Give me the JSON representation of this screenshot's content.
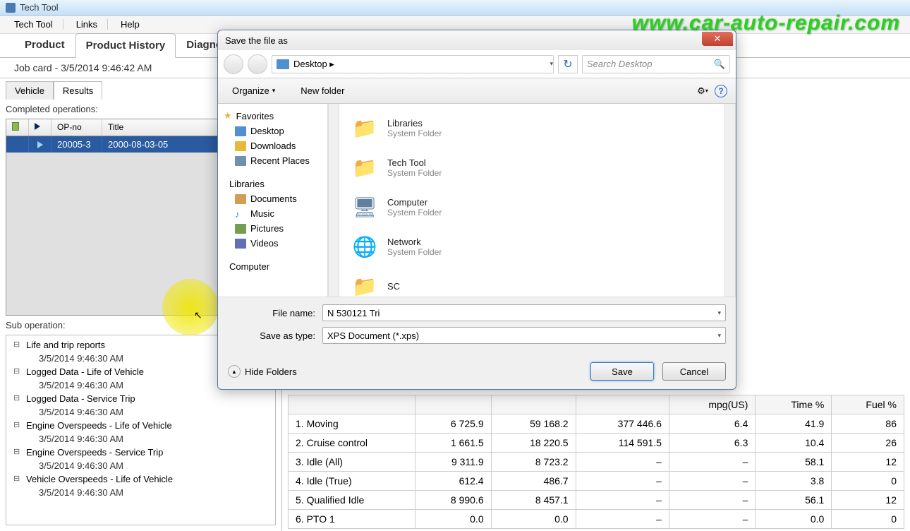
{
  "window": {
    "title": "Tech Tool"
  },
  "menu": {
    "items": [
      "Tech Tool",
      "Links",
      "Help"
    ]
  },
  "main_tabs": {
    "items": [
      "Product",
      "Product History",
      "Diagnose"
    ],
    "active_index": 1
  },
  "job_card": {
    "text": "Job card  -  3/5/2014 9:46:42 AM"
  },
  "sub_tabs": {
    "items": [
      "Vehicle",
      "Results"
    ],
    "active_index": 1
  },
  "ops": {
    "label": "Completed operations:",
    "headers": {
      "op": "OP-no",
      "title": "Title"
    },
    "row": {
      "op": "20005-3",
      "title": "2000-08-03-05"
    }
  },
  "sub_op": {
    "label": "Sub operation:",
    "nodes": [
      {
        "title": "Life and trip reports",
        "time": "3/5/2014 9:46:30 AM"
      },
      {
        "title": "Logged Data - Life of Vehicle",
        "time": "3/5/2014 9:46:30 AM"
      },
      {
        "title": "Logged Data - Service Trip",
        "time": "3/5/2014 9:46:30 AM"
      },
      {
        "title": "Engine Overspeeds - Life of Vehicle",
        "time": "3/5/2014 9:46:30 AM"
      },
      {
        "title": "Engine Overspeeds - Service Trip",
        "time": "3/5/2014 9:46:30 AM"
      },
      {
        "title": "Vehicle Overspeeds - Life of Vehicle",
        "time": "3/5/2014 9:46:30 AM"
      }
    ]
  },
  "data_table": {
    "headers": [
      "",
      "",
      "",
      "",
      "mpg(US)",
      "Time %",
      "Fuel %"
    ],
    "rows": [
      [
        "1. Moving",
        "6 725.9",
        "59 168.2",
        "377 446.6",
        "6.4",
        "41.9",
        "86"
      ],
      [
        "2. Cruise control",
        "1 661.5",
        "18 220.5",
        "114 591.5",
        "6.3",
        "10.4",
        "26"
      ],
      [
        "3. Idle (All)",
        "9 311.9",
        "8 723.2",
        "–",
        "–",
        "58.1",
        "12"
      ],
      [
        "4. Idle (True)",
        "612.4",
        "486.7",
        "–",
        "–",
        "3.8",
        "0"
      ],
      [
        "5. Qualified Idle",
        "8 990.6",
        "8 457.1",
        "–",
        "–",
        "56.1",
        "12"
      ],
      [
        "6. PTO 1",
        "0.0",
        "0.0",
        "–",
        "–",
        "0.0",
        "0"
      ]
    ]
  },
  "dialog": {
    "title": "Save the file as",
    "breadcrumb": "Desktop  ▸",
    "search_placeholder": "Search Desktop",
    "toolbar": {
      "organize": "Organize",
      "newfolder": "New folder"
    },
    "sidebar": {
      "favorites": "Favorites",
      "fav_items": [
        "Desktop",
        "Downloads",
        "Recent Places"
      ],
      "libraries": "Libraries",
      "lib_items": [
        "Documents",
        "Music",
        "Pictures",
        "Videos"
      ],
      "computer": "Computer"
    },
    "files": [
      {
        "name": "Libraries",
        "sub": "System Folder",
        "icon": "folder"
      },
      {
        "name": "Tech Tool",
        "sub": "System Folder",
        "icon": "folder"
      },
      {
        "name": "Computer",
        "sub": "System Folder",
        "icon": "computer"
      },
      {
        "name": "Network",
        "sub": "System Folder",
        "icon": "network"
      },
      {
        "name": "SC",
        "sub": "",
        "icon": "folder"
      }
    ],
    "filename_label": "File name:",
    "filename_value": "N 530121 Tri",
    "saveas_label": "Save as type:",
    "saveas_value": "XPS Document (*.xps)",
    "hide_folders": "Hide Folders",
    "save_btn": "Save",
    "cancel_btn": "Cancel"
  },
  "watermark": "www.car-auto-repair.com"
}
